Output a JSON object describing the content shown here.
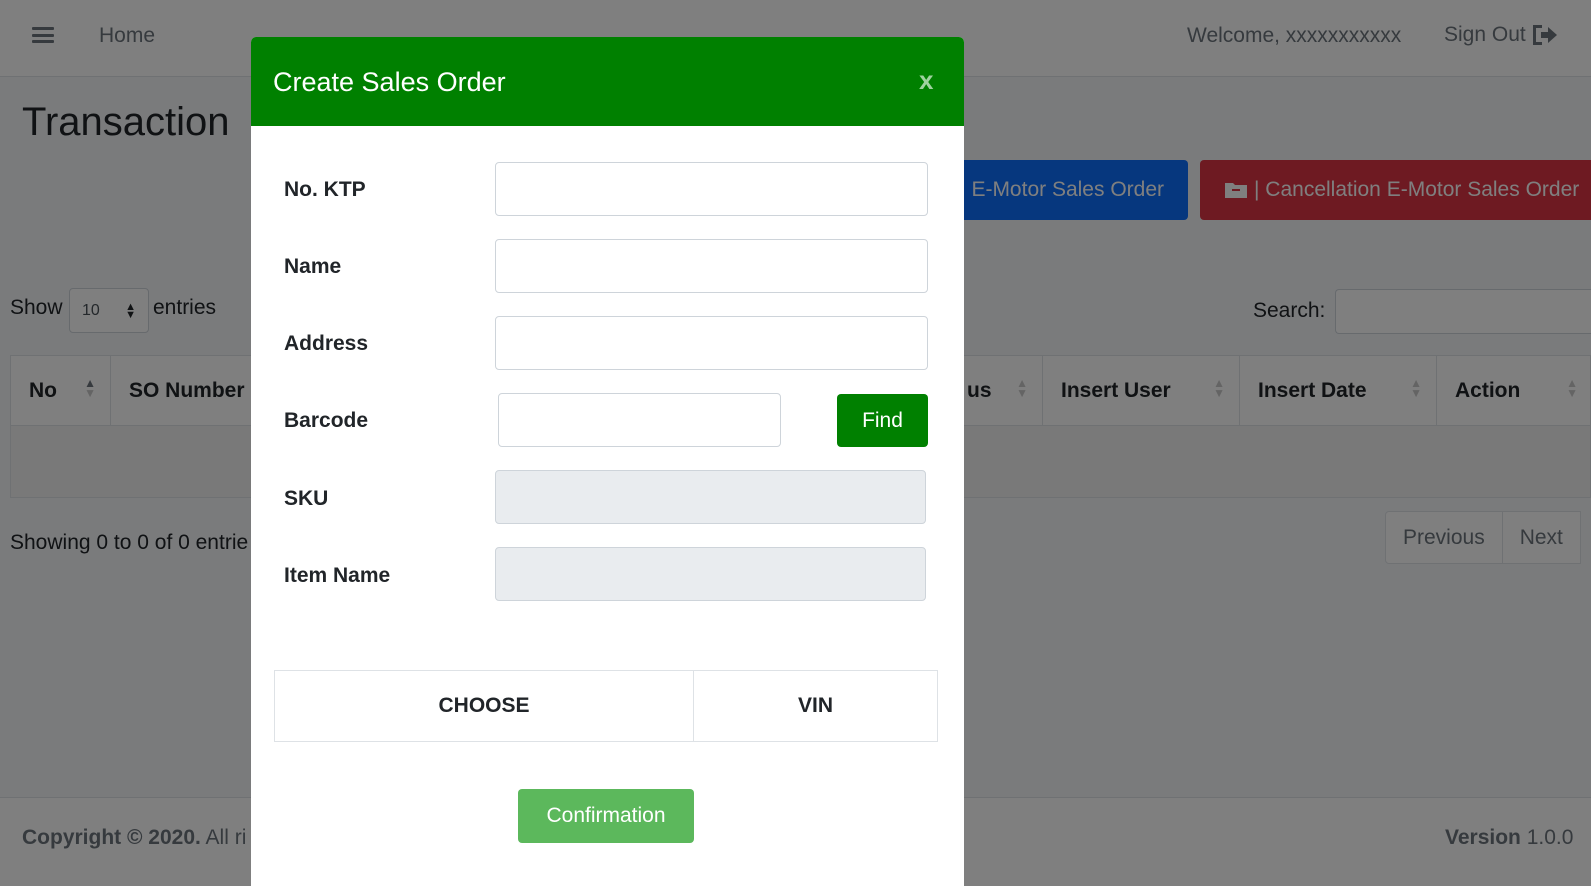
{
  "navbar": {
    "home": "Home",
    "welcome": "Welcome, xxxxxxxxxxx",
    "sign_out": "Sign Out"
  },
  "page": {
    "title": "Transaction",
    "btn_create_partial": "E-Motor Sales Order",
    "btn_cancel": "| Cancellation E-Motor Sales Order"
  },
  "table_controls": {
    "show": "Show",
    "page_size": "10",
    "entries": "entries",
    "search_label": "Search:"
  },
  "table": {
    "columns": [
      "No",
      "SO Number",
      "us",
      "Insert User",
      "Insert Date",
      "Action"
    ]
  },
  "info": "Showing 0 to 0 of 0 entrie",
  "pager": {
    "previous": "Previous",
    "next": "Next"
  },
  "footer": {
    "copyright_bold": "Copyright © 2020.",
    "copyright_rest": " All ri",
    "version_label": "Version",
    "version_value": " 1.0.0"
  },
  "modal": {
    "title": "Create Sales Order",
    "close": "x",
    "fields": {
      "ktp": {
        "label": "No. KTP",
        "value": ""
      },
      "name": {
        "label": "Name",
        "value": ""
      },
      "address": {
        "label": "Address",
        "value": ""
      },
      "barcode": {
        "label": "Barcode",
        "value": ""
      },
      "sku": {
        "label": "SKU",
        "value": ""
      },
      "item_name": {
        "label": "Item Name",
        "value": ""
      }
    },
    "find": "Find",
    "choose_header": "CHOOSE",
    "vin_header": "VIN",
    "confirm": "Confirmation"
  },
  "colors": {
    "modal_header": "#008000",
    "find_button": "#008000",
    "confirm_button": "#5cb85c",
    "blue_button": "#0d6efd",
    "red_button": "#dc3545"
  }
}
